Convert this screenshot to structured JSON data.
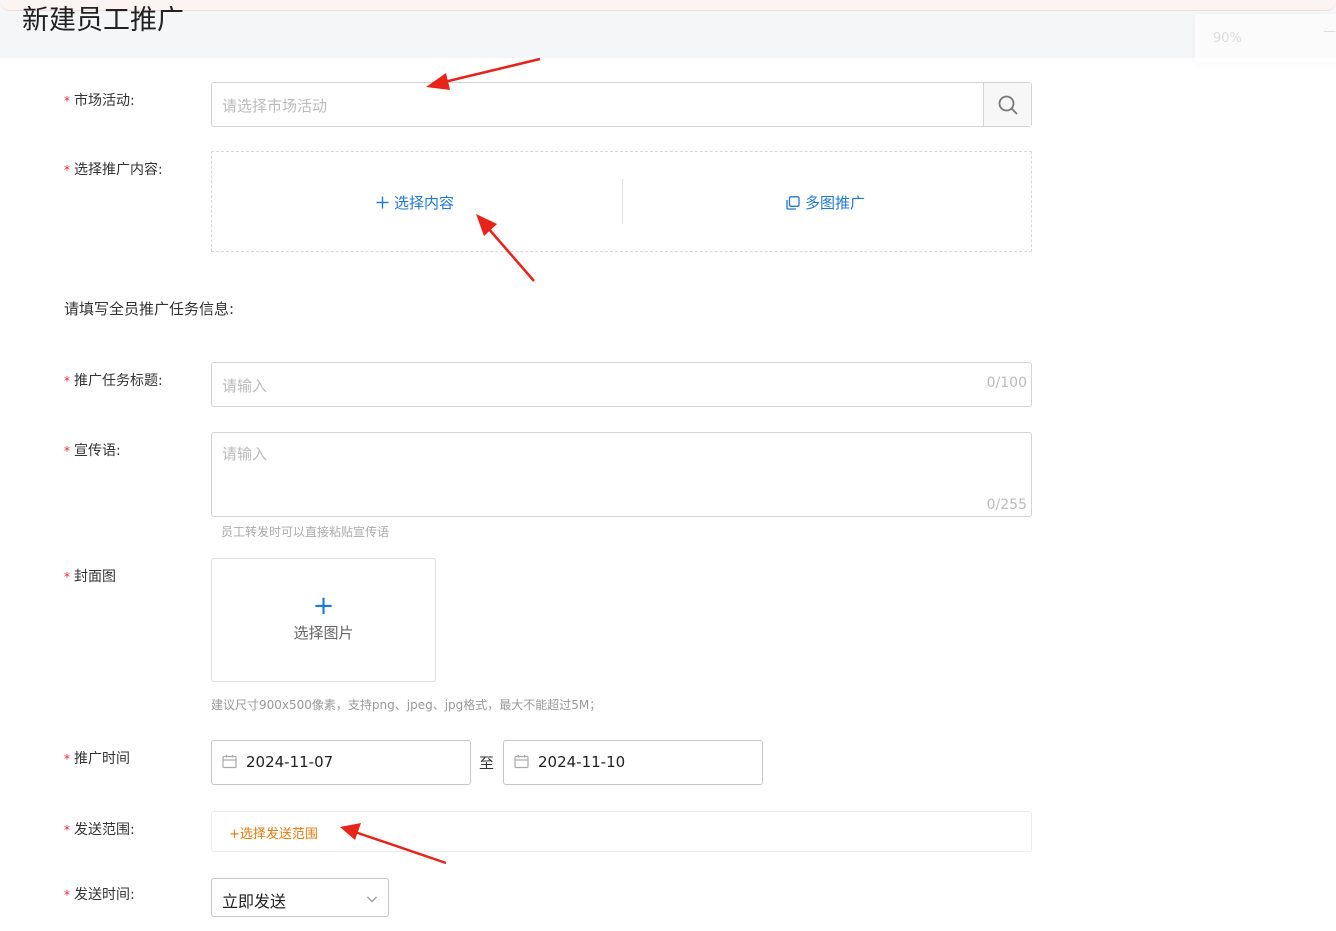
{
  "header": {
    "title": "新建员工推广"
  },
  "zoom": {
    "value": "90%",
    "dash": "—"
  },
  "form": {
    "required_mark": "*",
    "market_activity": {
      "label": "市场活动:",
      "placeholder": "请选择市场活动"
    },
    "content": {
      "label": "选择推广内容:",
      "select_label": "选择内容",
      "multi_label": "多图推广"
    },
    "section_heading": "请填写全员推广任务信息:",
    "task_title": {
      "label": "推广任务标题:",
      "placeholder": "请输入",
      "counter": "0/100"
    },
    "slogan": {
      "label": "宣传语:",
      "placeholder": "请输入",
      "counter": "0/255",
      "hint": "员工转发时可以直接粘贴宣传语"
    },
    "cover": {
      "label": "封面图",
      "plus": "+",
      "upload_label": "选择图片",
      "hint": "建议尺寸900x500像素，支持png、jpeg、jpg格式，最大不能超过5M；"
    },
    "period": {
      "label": "推广时间",
      "start": "2024-11-07",
      "separator": "至",
      "end": "2024-11-10"
    },
    "scope": {
      "label": "发送范围:",
      "link": "+选择发送范围"
    },
    "send_time": {
      "label": "发送时间:",
      "value": "立即发送"
    }
  },
  "colors": {
    "accent": "#1e7ad6",
    "required": "#f5222d",
    "scope_link": "#e8780c",
    "annotation_arrow": "#e8231a"
  }
}
